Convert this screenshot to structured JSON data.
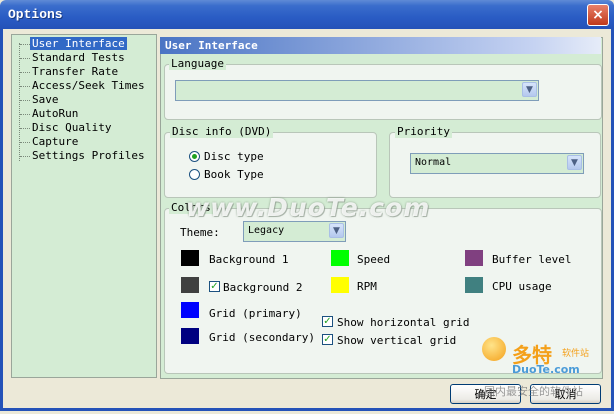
{
  "window": {
    "title": "Options",
    "close_label": "×"
  },
  "tree": {
    "items": [
      {
        "label": "User Interface",
        "selected": true
      },
      {
        "label": "Standard Tests"
      },
      {
        "label": "Transfer Rate"
      },
      {
        "label": "Access/Seek Times"
      },
      {
        "label": "Save"
      },
      {
        "label": "AutoRun"
      },
      {
        "label": "Disc Quality"
      },
      {
        "label": "Capture"
      },
      {
        "label": "Settings Profiles"
      }
    ]
  },
  "panel": {
    "title": "User Interface",
    "language": {
      "label": "Language",
      "value": ""
    },
    "disc_info": {
      "label": "Disc info (DVD)",
      "options": [
        "Disc type",
        "Book Type"
      ],
      "selected": "Disc type"
    },
    "priority": {
      "label": "Priority",
      "value": "Normal"
    },
    "colors": {
      "label": "Colors",
      "theme_label": "Theme:",
      "theme_value": "Legacy",
      "items": [
        {
          "label": "Background 1",
          "color": "#000000"
        },
        {
          "label": "Background 2",
          "color": "#404040",
          "checkbox": true
        },
        {
          "label": "Grid (primary)",
          "color": "#0000ff"
        },
        {
          "label": "Grid (secondary)",
          "color": "#000080"
        },
        {
          "label": "Speed",
          "color": "#00ff00"
        },
        {
          "label": "RPM",
          "color": "#ffff00"
        },
        {
          "label": "Buffer level",
          "color": "#804080"
        },
        {
          "label": "CPU usage",
          "color": "#408080"
        }
      ],
      "show_horizontal_grid": "Show horizontal grid",
      "show_vertical_grid": "Show vertical grid"
    }
  },
  "buttons": {
    "ok": "确定",
    "cancel": "取消"
  },
  "watermark": {
    "text": "www.DuoTe.com",
    "logo_cn": "多特",
    "logo_sub": "软件站",
    "logo_site": "DuoTe.com",
    "bottom_cn": "国内最安全的软件站"
  },
  "accent_color": "#3169c6"
}
